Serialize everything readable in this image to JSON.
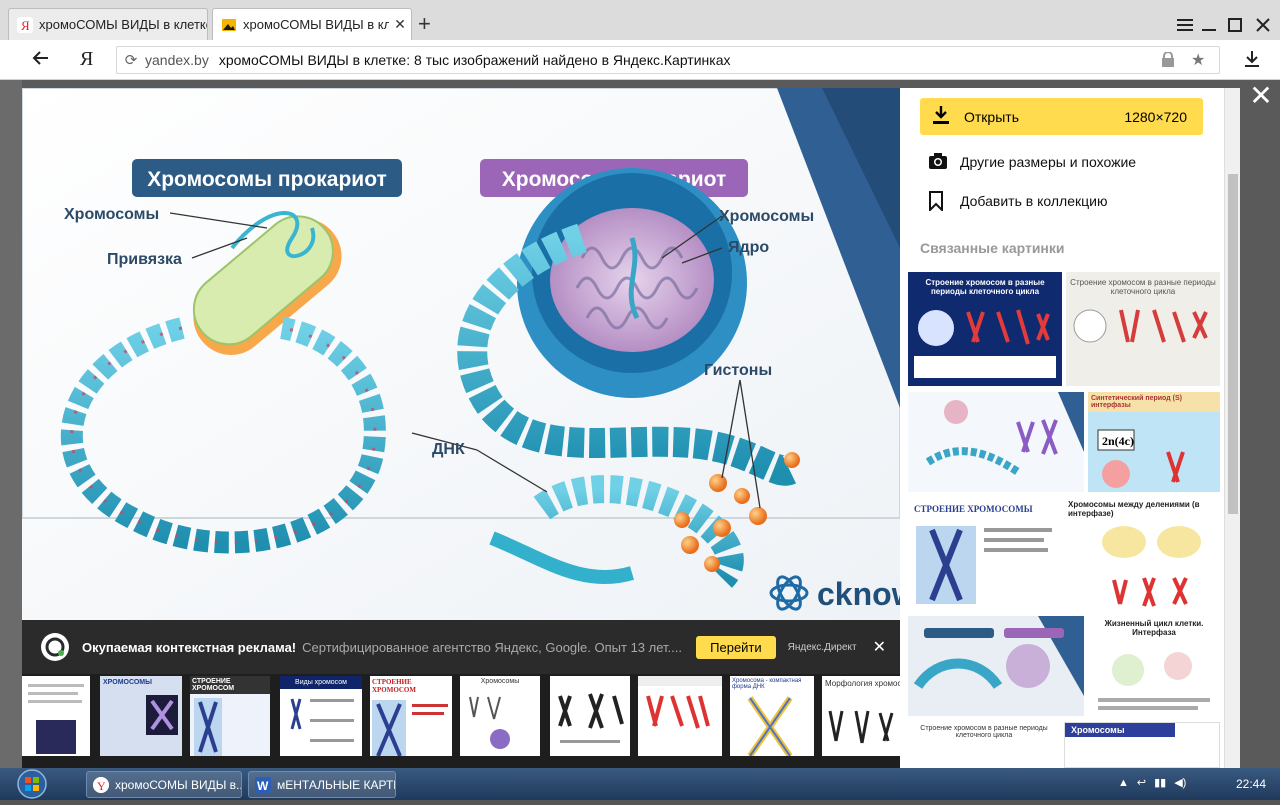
{
  "browser": {
    "tabs": [
      {
        "title": "хромоСОМЫ ВИДЫ в клетке",
        "favicon": "yandex-icon",
        "active": false
      },
      {
        "title": "хромоСОМЫ ВИДЫ в клетке",
        "favicon": "image-icon",
        "active": true
      }
    ],
    "new_tab": "+",
    "address": {
      "domain": "yandex.by",
      "title": "хромоСОМЫ ВИДЫ в клетке: 8 тыс изображений найдено в Яндекс.Картинках"
    },
    "logo": "Я"
  },
  "viewer": {
    "image": {
      "label_prokaryote": "Хромосомы прокариот",
      "label_eukaryote": "Хромосомы эукариот",
      "ann_chromosomes_left": "Хромосомы",
      "ann_attachment": "Привязка",
      "ann_chromosomes_right": "Хромосомы",
      "ann_nucleus": "Ядро",
      "ann_histones": "Гистоны",
      "ann_dna": "ДНК",
      "watermark": "cknow"
    },
    "close": "✕"
  },
  "panel": {
    "open_label": "Открыть",
    "resolution": "1280×720",
    "other_sizes": "Другие размеры и похожие",
    "add_collection": "Добавить в коллекцию",
    "related_title": "Связанные картинки",
    "thumbs": [
      {
        "caption": "Строение хромосом в разные периоды клеточного цикла"
      },
      {
        "caption": "Строение хромосом в разные периоды клеточного цикла"
      },
      {
        "caption": ""
      },
      {
        "caption": "Синтетический период (S) интерфазы"
      },
      {
        "caption": "СТРОЕНИЕ ХРОМОСОМЫ"
      },
      {
        "caption": "Хромосомы между делениями (в интерфазе)"
      },
      {
        "caption": ""
      },
      {
        "caption": "Жизненный цикл клетки. Интерфаза"
      },
      {
        "caption": "Строение хромосом в разные периоды клеточного цикла"
      },
      {
        "caption": "Хромосомы"
      }
    ]
  },
  "ad": {
    "headline": "Окупаемая контекстная реклама!",
    "text": "Сертифицированное агентство Яндекс, Google. Опыт 13 лет....",
    "button": "Перейти",
    "source": "Яндекс.Директ",
    "close": "✕"
  },
  "filmstrip": [
    {
      "caption": ""
    },
    {
      "caption": "ХРОМОСОМЫ"
    },
    {
      "caption": "СТРОЕНИЕ ХРОМОСОМ"
    },
    {
      "caption": "Виды хромосом"
    },
    {
      "caption": "СТРОЕНИЕ ХРОМОСОМ"
    },
    {
      "caption": "Хромосомы"
    },
    {
      "caption": ""
    },
    {
      "caption": ""
    },
    {
      "caption": "Хромосома - компактная форма ДНК"
    },
    {
      "caption": "Морфология хромосом"
    }
  ],
  "taskbar": {
    "items": [
      {
        "label": "хромоСОМЫ ВИДЫ в..."
      },
      {
        "label": "мЕНТАЛЬНЫЕ КАРТЫ..."
      }
    ],
    "clock": "22:44"
  },
  "colors": {
    "accent": "#ffdb4d",
    "prokaryote_banner": "#2c5b86",
    "eukaryote_banner": "#9b65b8"
  }
}
